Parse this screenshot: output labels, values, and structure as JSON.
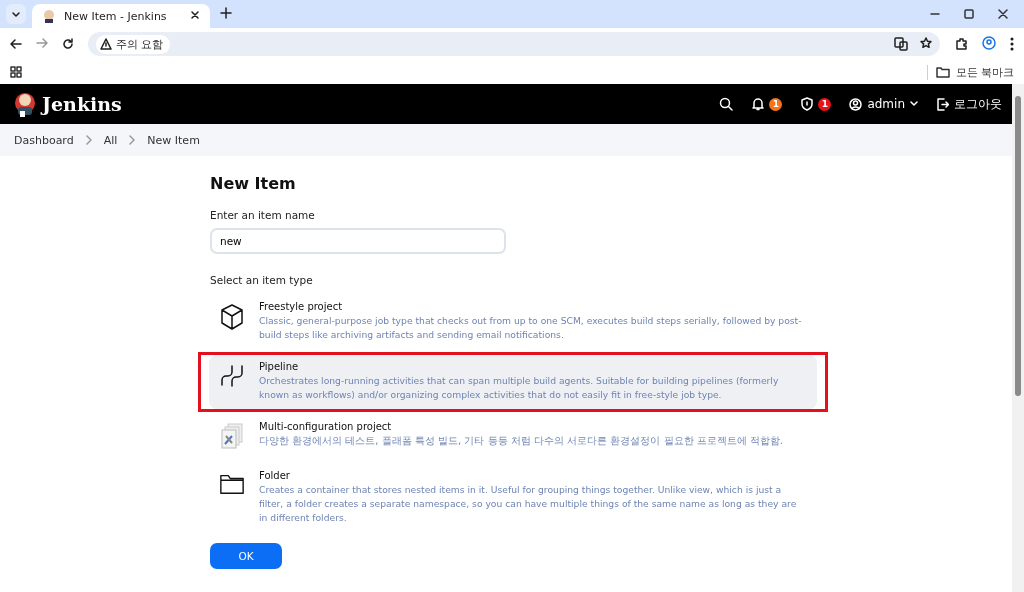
{
  "browser": {
    "tabs": [
      {
        "title": "New Item - Jenkins",
        "selected": true
      }
    ],
    "address": {
      "security_label": "주의 요함"
    },
    "bookmarks": {
      "folder": "모든 북마크"
    }
  },
  "header": {
    "brand": "Jenkins",
    "notifications": [
      {
        "kind": "bell",
        "count": "1",
        "color": "#f97316"
      },
      {
        "kind": "shield",
        "count": "1",
        "color": "#e5131b"
      }
    ],
    "user": "admin",
    "logout": "로그아웃"
  },
  "breadcrumbs": [
    "Dashboard",
    "All",
    "New Item"
  ],
  "page": {
    "title": "New Item",
    "name_label": "Enter an item name",
    "name_value": "new",
    "type_label": "Select an item type"
  },
  "item_types": [
    {
      "kind": "freestyle",
      "name": "Freestyle project",
      "description": "Classic, general-purpose job type that checks out from up to one SCM, executes build steps serially, followed by post-build steps like archiving artifacts and sending email notifications.",
      "selected": false,
      "highlighted": false
    },
    {
      "kind": "pipeline",
      "name": "Pipeline",
      "description": "Orchestrates long-running activities that can span multiple build agents. Suitable for building pipelines (formerly known as workflows) and/or organizing complex activities that do not easily fit in free-style job type.",
      "selected": true,
      "highlighted": true
    },
    {
      "kind": "multiconfig",
      "name": "Multi-configuration project",
      "description": "다양한 환경에서의 테스트, 플래폼 특성 빌드, 기타 등등 처럼 다수의 서로다른 환경설정이 필요한 프로젝트에 적합함.",
      "selected": false,
      "highlighted": false
    },
    {
      "kind": "folder",
      "name": "Folder",
      "description": "Creates a container that stores nested items in it. Useful for grouping things together. Unlike view, which is just a filter, a folder creates a separate namespace, so you can have multiple things of the same name as long as they are in different folders.",
      "selected": false,
      "highlighted": false
    }
  ],
  "ok_button": "OK"
}
